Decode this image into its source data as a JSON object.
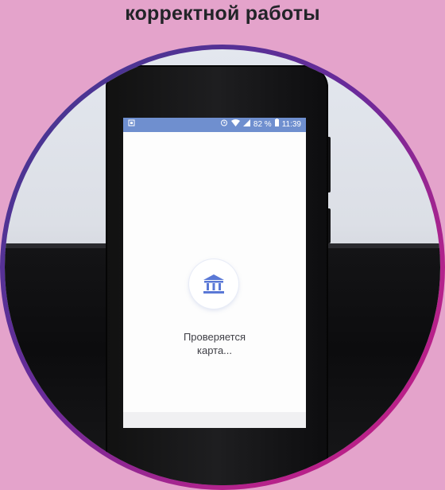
{
  "header": {
    "title": "корректной работы"
  },
  "phone": {
    "status_bar": {
      "left_icon": "notification-icon",
      "alarm_icon": "alarm-icon",
      "wifi_icon": "wifi-icon",
      "signal_icon": "signal-icon",
      "battery_percent": "82 %",
      "battery_icon": "battery-icon",
      "time": "11:39"
    },
    "screen": {
      "bank_icon": "bank-icon",
      "message_line1": "Проверяется",
      "message_line2": "карта..."
    }
  },
  "colors": {
    "page_background": "#e4a3cb",
    "ring_start": "#3b3a8f",
    "ring_end": "#c31a83",
    "status_bar": "#6f8fcf",
    "bank_icon_accent": "#5a78d6"
  }
}
